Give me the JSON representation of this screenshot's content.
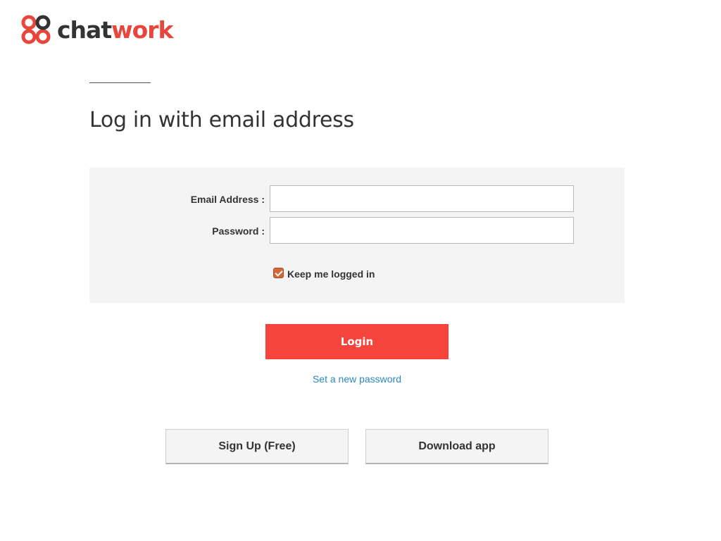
{
  "brand": {
    "name_part1": "chat",
    "name_part2": "work",
    "accent_color": "#e8453c",
    "logo_icon": "chatwork-flower-logo"
  },
  "header": {
    "title": "Log in with email address"
  },
  "form": {
    "email_label": "Email Address :",
    "email_value": "",
    "password_label": "Password :",
    "password_value": "",
    "keep_logged_in_label": "Keep me logged in",
    "keep_logged_in_checked": true
  },
  "actions": {
    "login_label": "Login",
    "login_color": "#f6433c",
    "reset_link": "Set a new password",
    "signup_label": "Sign Up (Free)",
    "download_label": "Download app"
  }
}
